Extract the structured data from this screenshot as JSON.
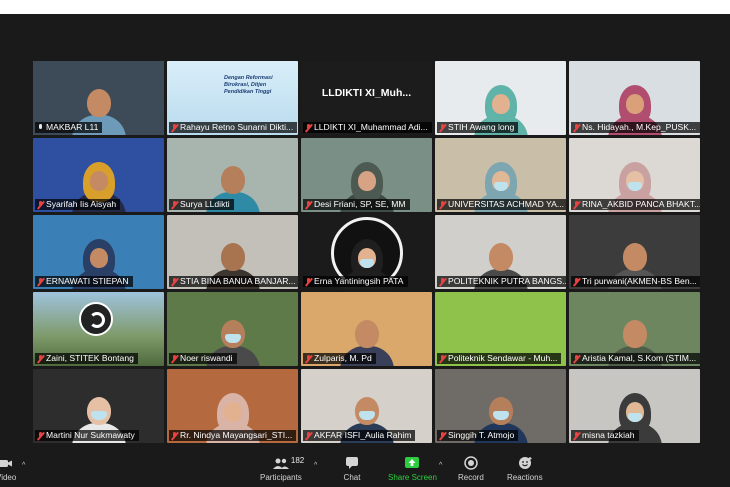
{
  "meeting": {
    "tiles": [
      {
        "name": "MAKBAR L11",
        "bg": "#3d4a58",
        "type": "person",
        "active": true,
        "skin": "#c48a63",
        "torso": "#6c9ab8",
        "mic": "on"
      },
      {
        "name": "Rahayu Retno Sunarni Dikti...",
        "bg": "#cfe6f3",
        "type": "banner",
        "banner_text": "Dengan Reformasi Birokrasi, Ditjen Pendidikan Tinggi",
        "mic": "off"
      },
      {
        "name": "LLDIKTI XI_Muhammad Adi...",
        "bg": "#1c1c1c",
        "type": "text",
        "display_text": "LLDIKTI XI_Muh...",
        "mic": "off"
      },
      {
        "name": "STIH Awang long",
        "bg": "#e7ebee",
        "type": "person",
        "hijab": "#5fb3a8",
        "skin": "#e2b190",
        "torso": "#5fb3a8",
        "mic": "off"
      },
      {
        "name": "Ns. Hidayah., M.Kep_PUSK...",
        "bg": "#d8dee2",
        "type": "person",
        "hijab": "#b14d6e",
        "skin": "#d9a07a",
        "torso": "#b14d6e",
        "mic": "off"
      },
      {
        "name": "Syarifah Iis Aisyah",
        "bg": "#2f4fa0",
        "type": "person",
        "hijab": "#d8a02b",
        "skin": "#c48a63",
        "torso": "#222a48",
        "mic": "off"
      },
      {
        "name": "Surya LLdikti",
        "bg": "#a8b4ae",
        "type": "person",
        "skin": "#b67f5c",
        "torso": "#2f8aa6",
        "mic": "off"
      },
      {
        "name": "Desi Friani, SP, SE, MM",
        "bg": "#7a8f86",
        "type": "person",
        "hijab": "#4d5a52",
        "skin": "#d6a384",
        "torso": "#3f4c46",
        "mic": "off"
      },
      {
        "name": "UNIVERSITAS ACHMAD YA...",
        "bg": "#c9bfa8",
        "type": "person",
        "hijab": "#7ea6b0",
        "skin": "#e0b896",
        "torso": "#7ea6b0",
        "mask": true,
        "mic": "off"
      },
      {
        "name": "RINA_AKBID PANCA BHAKT...",
        "bg": "#dcd9d4",
        "type": "person",
        "hijab": "#c9a1a0",
        "skin": "#e6c0a5",
        "torso": "#c9a1a0",
        "mask": true,
        "mic": "off"
      },
      {
        "name": "ERNAWATI STIEPAN",
        "bg": "#3a7fb5",
        "type": "person",
        "hijab": "#2a3f66",
        "skin": "#c48a63",
        "torso": "#2a3f66",
        "mic": "off"
      },
      {
        "name": "STIA BINA BANUA BANJAR...",
        "bg": "#c3c0b9",
        "type": "person",
        "skin": "#a87450",
        "torso": "#3d3530",
        "mic": "off"
      },
      {
        "name": "Erna Yantiningsih PATA",
        "bg": "#1b1b1b",
        "type": "logo",
        "skin": "#e2b190",
        "hijab": "#1f1f1f",
        "torso": "#1f1f1f",
        "mask": true,
        "mic": "off"
      },
      {
        "name": "POLITEKNIK PUTRA BANGS...",
        "bg": "#d1cfcc",
        "type": "person",
        "skin": "#c48a63",
        "torso": "#4a4a4a",
        "mic": "off"
      },
      {
        "name": "Tri purwani(AKMEN-BS Ben...",
        "bg": "#3c3c3c",
        "type": "person",
        "skin": "#c48a63",
        "torso": "#555555",
        "mic": "off"
      },
      {
        "name": "Zaini, STITEK Bontang",
        "bg": "#7e9a6a",
        "type": "obs",
        "mic": "off"
      },
      {
        "name": "Noer riswandi",
        "bg": "#5e7a48",
        "type": "person",
        "skin": "#b67f5c",
        "torso": "#4a4a4a",
        "mask": true,
        "mic": "off"
      },
      {
        "name": "Zulparis, M. Pd",
        "bg": "#d9a86a",
        "type": "person",
        "skin": "#c48a63",
        "torso": "#3a3f5a",
        "mic": "off"
      },
      {
        "name": "Politeknik Sendawar - Muh...",
        "bg": "#8ec24a",
        "type": "plain",
        "mic": "off"
      },
      {
        "name": "Aristia Kamal, S.Kom (STIM...",
        "bg": "#6e8660",
        "type": "person",
        "skin": "#c48a63",
        "torso": "#4f5e49",
        "mic": "off"
      },
      {
        "name": "Martini Nur Sukmawaty",
        "bg": "#2d2d2d",
        "type": "person",
        "skin": "#e6c0a5",
        "torso": "#e8e8e8",
        "mask": true,
        "mic": "off"
      },
      {
        "name": "Rr. Nindya Mayangsari_STI...",
        "bg": "#b46a3e",
        "type": "person",
        "hijab": "#d9b3a6",
        "skin": "#e2b190",
        "torso": "#d9b3a6",
        "mic": "off"
      },
      {
        "name": "AKFAR ISFI_Aulia Rahim",
        "bg": "#d5d1ca",
        "type": "person",
        "skin": "#c48a63",
        "torso": "#2a3c57",
        "mask": true,
        "mic": "off"
      },
      {
        "name": "Singgih T. Atmojo",
        "bg": "#6f6b66",
        "type": "person",
        "skin": "#b67f5c",
        "torso": "#20365a",
        "mask": true,
        "mic": "off"
      },
      {
        "name": "misna tazkiah",
        "bg": "#c8c6c2",
        "type": "person",
        "hijab": "#3b3b3b",
        "skin": "#e0b896",
        "torso": "#3b3b3b",
        "mask": true,
        "mic": "off"
      }
    ]
  },
  "toolbar": {
    "video_label": "Video",
    "participants_label": "Participants",
    "participants_count": "182",
    "chat_label": "Chat",
    "share_label": "Share Screen",
    "record_label": "Record",
    "reactions_label": "Reactions",
    "share_color": "#2ecc40"
  }
}
